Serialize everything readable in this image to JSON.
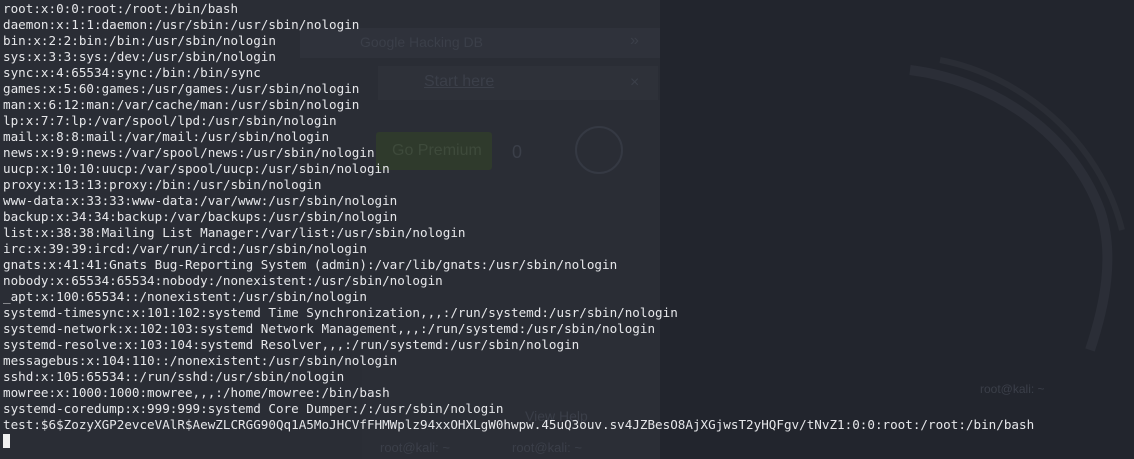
{
  "background": {
    "browser_tab": "Google Hacking DB",
    "start_link": "Start here",
    "premium_button": "Go Premium",
    "streak_count": "0",
    "close_glyph": "×",
    "more_glyph": "»",
    "panel_tabs": [
      "root@kali: ~",
      "root@kali: ~"
    ],
    "menu_text": "View  Help",
    "side_label": "root@kali: ~"
  },
  "terminal": {
    "lines": [
      "root:x:0:0:root:/root:/bin/bash",
      "daemon:x:1:1:daemon:/usr/sbin:/usr/sbin/nologin",
      "bin:x:2:2:bin:/bin:/usr/sbin/nologin",
      "sys:x:3:3:sys:/dev:/usr/sbin/nologin",
      "sync:x:4:65534:sync:/bin:/bin/sync",
      "games:x:5:60:games:/usr/games:/usr/sbin/nologin",
      "man:x:6:12:man:/var/cache/man:/usr/sbin/nologin",
      "lp:x:7:7:lp:/var/spool/lpd:/usr/sbin/nologin",
      "mail:x:8:8:mail:/var/mail:/usr/sbin/nologin",
      "news:x:9:9:news:/var/spool/news:/usr/sbin/nologin",
      "uucp:x:10:10:uucp:/var/spool/uucp:/usr/sbin/nologin",
      "proxy:x:13:13:proxy:/bin:/usr/sbin/nologin",
      "www-data:x:33:33:www-data:/var/www:/usr/sbin/nologin",
      "backup:x:34:34:backup:/var/backups:/usr/sbin/nologin",
      "list:x:38:38:Mailing List Manager:/var/list:/usr/sbin/nologin",
      "irc:x:39:39:ircd:/var/run/ircd:/usr/sbin/nologin",
      "gnats:x:41:41:Gnats Bug-Reporting System (admin):/var/lib/gnats:/usr/sbin/nologin",
      "nobody:x:65534:65534:nobody:/nonexistent:/usr/sbin/nologin",
      "_apt:x:100:65534::/nonexistent:/usr/sbin/nologin",
      "systemd-timesync:x:101:102:systemd Time Synchronization,,,:/run/systemd:/usr/sbin/nologin",
      "systemd-network:x:102:103:systemd Network Management,,,:/run/systemd:/usr/sbin/nologin",
      "systemd-resolve:x:103:104:systemd Resolver,,,:/run/systemd:/usr/sbin/nologin",
      "messagebus:x:104:110::/nonexistent:/usr/sbin/nologin",
      "sshd:x:105:65534::/run/sshd:/usr/sbin/nologin",
      "mowree:x:1000:1000:mowree,,,:/home/mowree:/bin/bash",
      "systemd-coredump:x:999:999:systemd Core Dumper:/:/usr/sbin/nologin",
      "test:$6$ZozyXGP2evceVAlR$AewZLCRGG90Qq1A5MoJHCVfFHMWplz94xxOHXLgW0hwpw.45uQ3ouv.sv4JZBesO8AjXGjwsT2yHQFgv/tNvZ1:0:0:root:/root:/bin/bash"
    ]
  },
  "colors": {
    "terminal_background": "#22252d",
    "terminal_text": "#e6e7ea",
    "cursor": "#f0f0f0"
  }
}
